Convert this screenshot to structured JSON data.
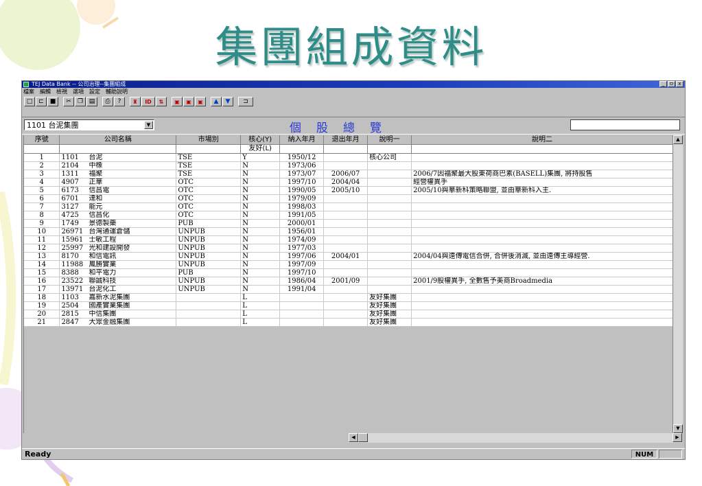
{
  "slide_title": "集團組成資料",
  "window": {
    "title": "TEJ Data Bank -- 公司治理--集團組成",
    "controls": [
      "_",
      "ㅁ",
      "x"
    ]
  },
  "menu": [
    "檔案",
    "編輯",
    "檢視",
    "選項",
    "設定",
    "輔助說明"
  ],
  "toolbar": {
    "id_label": "ID",
    "buttons": [
      "new-icon",
      "open-icon",
      "save-icon",
      "cut-icon",
      "copy-icon",
      "paste-icon",
      "print-icon",
      "help-icon",
      "tej-icon",
      "id-icon",
      "sort-icon",
      "export1-icon",
      "export2-icon",
      "export3-icon",
      "up-arrow-icon",
      "down-arrow-icon",
      "exit-icon"
    ]
  },
  "filter": {
    "company_select": "1101  台泥集團",
    "heading": "個股總覽",
    "right_input": ""
  },
  "table": {
    "headers": {
      "no": "序號",
      "name": "公司名稱",
      "market": "市場別",
      "core": "核心(Y)",
      "core_sub": "友好(L)",
      "join": "納入年月",
      "exit": "退出年月",
      "desc1": "說明一",
      "desc2": "說明二"
    },
    "rows": [
      {
        "no": "1",
        "code": "1101",
        "name": "台泥",
        "market": "TSE",
        "core": "Y",
        "join": "1950/12",
        "exit": "",
        "desc1": "核心公司",
        "desc2": ""
      },
      {
        "no": "2",
        "code": "2104",
        "name": "中橡",
        "market": "TSE",
        "core": "N",
        "join": "1973/06",
        "exit": "",
        "desc1": "",
        "desc2": ""
      },
      {
        "no": "3",
        "code": "1311",
        "name": "福聚",
        "market": "TSE",
        "core": "N",
        "join": "1973/07",
        "exit": "2006/07",
        "desc1": "",
        "desc2": "2006/7因福聚最大股東荷商巴素(BASELL)集團, 將持股售"
      },
      {
        "no": "4",
        "code": "4907",
        "name": "正華",
        "market": "OTC",
        "core": "N",
        "join": "1997/10",
        "exit": "2004/04",
        "desc1": "",
        "desc2": "經營權異手"
      },
      {
        "no": "5",
        "code": "6173",
        "name": "信昌電",
        "market": "OTC",
        "core": "N",
        "join": "1990/05",
        "exit": "2005/10",
        "desc1": "",
        "desc2": "2005/10與華新科策略聯盟, 並由華新科入主."
      },
      {
        "no": "6",
        "code": "6701",
        "name": "達和",
        "market": "OTC",
        "core": "N",
        "join": "1979/09",
        "exit": "",
        "desc1": "",
        "desc2": ""
      },
      {
        "no": "7",
        "code": "3127",
        "name": "能元",
        "market": "OTC",
        "core": "N",
        "join": "1998/03",
        "exit": "",
        "desc1": "",
        "desc2": ""
      },
      {
        "no": "8",
        "code": "4725",
        "name": "信昌化",
        "market": "OTC",
        "core": "N",
        "join": "1991/05",
        "exit": "",
        "desc1": "",
        "desc2": ""
      },
      {
        "no": "9",
        "code": "1749",
        "name": "景德製藥",
        "market": "PUB",
        "core": "N",
        "join": "2000/01",
        "exit": "",
        "desc1": "",
        "desc2": ""
      },
      {
        "no": "10",
        "code": "26971",
        "name": "台灣通運倉儲",
        "market": "UNPUB",
        "core": "N",
        "join": "1956/01",
        "exit": "",
        "desc1": "",
        "desc2": ""
      },
      {
        "no": "11",
        "code": "15961",
        "name": "士敏工程",
        "market": "UNPUB",
        "core": "N",
        "join": "1974/09",
        "exit": "",
        "desc1": "",
        "desc2": ""
      },
      {
        "no": "12",
        "code": "25997",
        "name": "光和建設開發",
        "market": "UNPUB",
        "core": "N",
        "join": "1977/03",
        "exit": "",
        "desc1": "",
        "desc2": ""
      },
      {
        "no": "13",
        "code": "8170",
        "name": "和信電訊",
        "market": "UNPUB",
        "core": "N",
        "join": "1997/06",
        "exit": "2004/01",
        "desc1": "",
        "desc2": "2004/04與遠傳電信合併, 合併後消滅, 並由遠傳主導經營."
      },
      {
        "no": "14",
        "code": "11988",
        "name": "鳳勝實業",
        "market": "UNPUB",
        "core": "N",
        "join": "1997/09",
        "exit": "",
        "desc1": "",
        "desc2": ""
      },
      {
        "no": "15",
        "code": "8388",
        "name": "和平電力",
        "market": "PUB",
        "core": "N",
        "join": "1997/10",
        "exit": "",
        "desc1": "",
        "desc2": ""
      },
      {
        "no": "16",
        "code": "23522",
        "name": "聯誠科技",
        "market": "UNPUB",
        "core": "N",
        "join": "1986/04",
        "exit": "2001/09",
        "desc1": "",
        "desc2": "2001/9股權異手, 全數售予美商Broadmedia"
      },
      {
        "no": "17",
        "code": "13971",
        "name": "台泥化工",
        "market": "UNPUB",
        "core": "N",
        "join": "1991/04",
        "exit": "",
        "desc1": "",
        "desc2": ""
      },
      {
        "no": "18",
        "code": "1103",
        "name": "嘉新水泥集團",
        "market": "",
        "core": "L",
        "join": "",
        "exit": "",
        "desc1": "友好集團",
        "desc2": ""
      },
      {
        "no": "19",
        "code": "2504",
        "name": "國產實業集團",
        "market": "",
        "core": "L",
        "join": "",
        "exit": "",
        "desc1": "友好集團",
        "desc2": ""
      },
      {
        "no": "20",
        "code": "2815",
        "name": "中信集團",
        "market": "",
        "core": "L",
        "join": "",
        "exit": "",
        "desc1": "友好集團",
        "desc2": ""
      },
      {
        "no": "21",
        "code": "2847",
        "name": "大眾金融集團",
        "market": "",
        "core": "L",
        "join": "",
        "exit": "",
        "desc1": "友好集團",
        "desc2": ""
      }
    ]
  },
  "status": {
    "ready": "Ready",
    "num": "NUM"
  },
  "colors": {
    "title_teal": "#2f8c86",
    "heading_blue": "#2a3ad6",
    "titlebar_blue": "#0a1d8a"
  }
}
